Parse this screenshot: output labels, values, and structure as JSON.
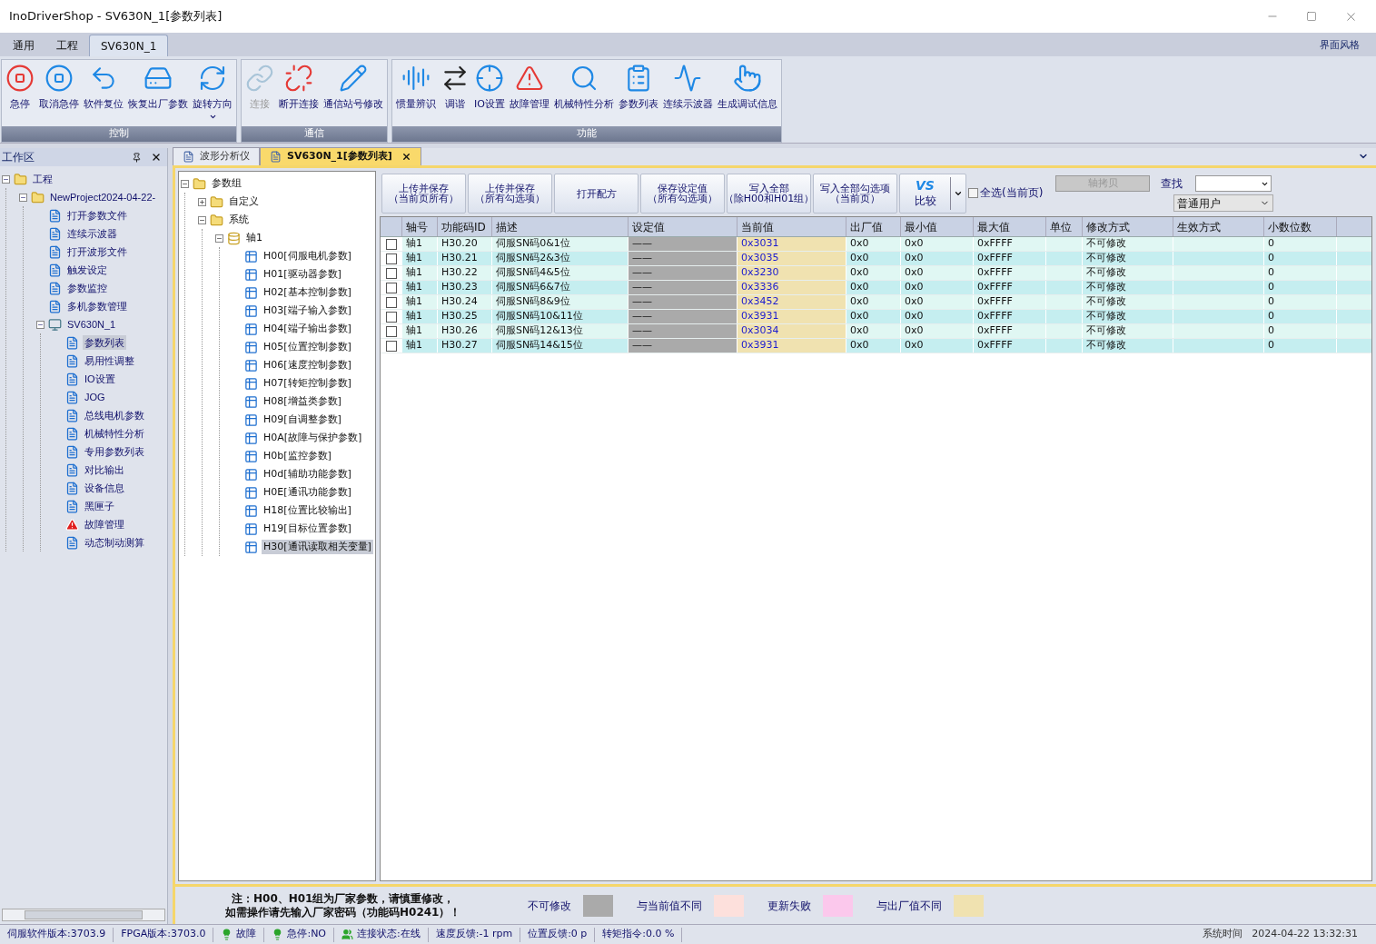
{
  "window": {
    "title": "InoDriverShop - SV630N_1[参数列表]"
  },
  "ribbon": {
    "tabs": [
      {
        "label": "通用",
        "selected": false
      },
      {
        "label": "工程",
        "selected": false
      },
      {
        "label": "SV630N_1",
        "selected": true
      }
    ],
    "style_link": "界面风格",
    "groups": [
      {
        "label": "控制",
        "buttons": [
          {
            "label": "急停",
            "disabled": false,
            "has_menu": false
          },
          {
            "label": "取消急停",
            "disabled": false,
            "has_menu": false
          },
          {
            "label": "软件复位",
            "disabled": false,
            "has_menu": false
          },
          {
            "label": "恢复出厂参数",
            "disabled": false,
            "has_menu": false
          },
          {
            "label": "旋转方向",
            "disabled": false,
            "has_menu": true
          }
        ]
      },
      {
        "label": "通信",
        "buttons": [
          {
            "label": "连接",
            "disabled": true,
            "has_menu": false
          },
          {
            "label": "断开连接",
            "disabled": false,
            "has_menu": false
          },
          {
            "label": "通信站号修改",
            "disabled": false,
            "has_menu": false
          }
        ]
      },
      {
        "label": "功能",
        "buttons": [
          {
            "label": "惯量辨识",
            "disabled": false,
            "has_menu": false
          },
          {
            "label": "调谐",
            "disabled": false,
            "has_menu": false
          },
          {
            "label": "IO设置",
            "disabled": false,
            "has_menu": false
          },
          {
            "label": "故障管理",
            "disabled": false,
            "has_menu": false
          },
          {
            "label": "机械特性分析",
            "disabled": false,
            "has_menu": false
          },
          {
            "label": "参数列表",
            "disabled": false,
            "has_menu": false
          },
          {
            "label": "连续示波器",
            "disabled": false,
            "has_menu": false
          },
          {
            "label": "生成调试信息",
            "disabled": false,
            "has_menu": false
          }
        ]
      }
    ]
  },
  "workspace": {
    "title": "工作区",
    "tree": [
      {
        "label": "工程",
        "kind": "folder",
        "selected": false,
        "expanded": true,
        "children": [
          {
            "label": "NewProject2024-04-22-",
            "kind": "folder",
            "selected": false,
            "expanded": true,
            "children": [
              {
                "label": "打开参数文件",
                "kind": "item",
                "selected": false
              },
              {
                "label": "连续示波器",
                "kind": "item",
                "selected": false
              },
              {
                "label": "打开波形文件",
                "kind": "item",
                "selected": false
              },
              {
                "label": "触发设定",
                "kind": "item",
                "selected": false
              },
              {
                "label": "参数监控",
                "kind": "item",
                "selected": false
              },
              {
                "label": "多机参数管理",
                "kind": "item",
                "selected": false
              },
              {
                "label": "SV630N_1",
                "kind": "device",
                "selected": false,
                "expanded": true,
                "children": [
                  {
                    "label": "参数列表",
                    "kind": "item",
                    "selected": true
                  },
                  {
                    "label": "易用性调整",
                    "kind": "item",
                    "selected": false
                  },
                  {
                    "label": "IO设置",
                    "kind": "item",
                    "selected": false
                  },
                  {
                    "label": "JOG",
                    "kind": "item",
                    "selected": false
                  },
                  {
                    "label": "总线电机参数",
                    "kind": "item",
                    "selected": false
                  },
                  {
                    "label": "机械特性分析",
                    "kind": "item",
                    "selected": false
                  },
                  {
                    "label": "专用参数列表",
                    "kind": "item",
                    "selected": false
                  },
                  {
                    "label": "对比输出",
                    "kind": "item",
                    "selected": false
                  },
                  {
                    "label": "设备信息",
                    "kind": "item",
                    "selected": false
                  },
                  {
                    "label": "黑匣子",
                    "kind": "item",
                    "selected": false
                  },
                  {
                    "label": "故障管理",
                    "kind": "alert",
                    "selected": false
                  },
                  {
                    "label": "动态制动测算",
                    "kind": "item",
                    "selected": false
                  }
                ]
              }
            ]
          }
        ]
      }
    ]
  },
  "doc_tabs": [
    {
      "label": "波形分析仪",
      "selected": false
    },
    {
      "label": "SV630N_1[参数列表]",
      "selected": true
    }
  ],
  "param_tree": [
    {
      "label": "参数组",
      "kind": "folder",
      "selected": false,
      "expanded": true,
      "children": [
        {
          "label": "自定义",
          "kind": "folder",
          "selected": false,
          "expanded": false
        },
        {
          "label": "系统",
          "kind": "folder",
          "selected": false,
          "expanded": true,
          "children": [
            {
              "label": "轴1",
              "kind": "axis",
              "selected": false,
              "expanded": true,
              "children": [
                {
                  "label": "H00[伺服电机参数]",
                  "kind": "group",
                  "selected": false
                },
                {
                  "label": "H01[驱动器参数]",
                  "kind": "group",
                  "selected": false
                },
                {
                  "label": "H02[基本控制参数]",
                  "kind": "group",
                  "selected": false
                },
                {
                  "label": "H03[端子输入参数]",
                  "kind": "group",
                  "selected": false
                },
                {
                  "label": "H04[端子输出参数]",
                  "kind": "group",
                  "selected": false
                },
                {
                  "label": "H05[位置控制参数]",
                  "kind": "group",
                  "selected": false
                },
                {
                  "label": "H06[速度控制参数]",
                  "kind": "group",
                  "selected": false
                },
                {
                  "label": "H07[转矩控制参数]",
                  "kind": "group",
                  "selected": false
                },
                {
                  "label": "H08[增益类参数]",
                  "kind": "group",
                  "selected": false
                },
                {
                  "label": "H09[自调整参数]",
                  "kind": "group",
                  "selected": false
                },
                {
                  "label": "H0A[故障与保护参数]",
                  "kind": "group",
                  "selected": false
                },
                {
                  "label": "H0b[监控参数]",
                  "kind": "group",
                  "selected": false
                },
                {
                  "label": "H0d[辅助功能参数]",
                  "kind": "group",
                  "selected": false
                },
                {
                  "label": "H0E[通讯功能参数]",
                  "kind": "group",
                  "selected": false
                },
                {
                  "label": "H18[位置比较输出]",
                  "kind": "group",
                  "selected": false
                },
                {
                  "label": "H19[目标位置参数]",
                  "kind": "group",
                  "selected": false
                },
                {
                  "label": "H30[通讯读取相关变量]",
                  "kind": "group",
                  "selected": true
                }
              ]
            }
          ]
        }
      ]
    }
  ],
  "toolbar": {
    "buttons": [
      {
        "line1": "上传并保存",
        "line2": "（当前页所有）"
      },
      {
        "line1": "上传并保存",
        "line2": "（所有勾选项）"
      },
      {
        "line1": "打开配方"
      },
      {
        "line1": "保存设定值",
        "line2": "（所有勾选项）"
      },
      {
        "line1": "写入全部",
        "line2": "（除H00和H01组）"
      },
      {
        "line1": "写入全部勾选项",
        "line2": "（当前页）"
      }
    ],
    "compare": {
      "logo": "VS",
      "label": "比较"
    },
    "select_all": {
      "label": "全选(当前页)",
      "checked": false
    },
    "axis_copy": {
      "label": "轴拷贝",
      "disabled": true
    },
    "find": {
      "label": "查找"
    },
    "user_level": {
      "value": "普通用户"
    }
  },
  "table": {
    "columns": [
      "轴号",
      "功能码ID",
      "描述",
      "设定值",
      "当前值",
      "出厂值",
      "最小值",
      "最大值",
      "单位",
      "修改方式",
      "生效方式",
      "小数位数"
    ],
    "rows": [
      {
        "checked": false,
        "cells": [
          "轴1",
          "H30.20",
          "伺服SN码0&1位",
          "——",
          "0x3031",
          "0x0",
          "0x0",
          "0xFFFF",
          "",
          "不可修改",
          "",
          "0"
        ]
      },
      {
        "checked": false,
        "cells": [
          "轴1",
          "H30.21",
          "伺服SN码2&3位",
          "——",
          "0x3035",
          "0x0",
          "0x0",
          "0xFFFF",
          "",
          "不可修改",
          "",
          "0"
        ]
      },
      {
        "checked": false,
        "cells": [
          "轴1",
          "H30.22",
          "伺服SN码4&5位",
          "——",
          "0x3230",
          "0x0",
          "0x0",
          "0xFFFF",
          "",
          "不可修改",
          "",
          "0"
        ]
      },
      {
        "checked": false,
        "cells": [
          "轴1",
          "H30.23",
          "伺服SN码6&7位",
          "——",
          "0x3336",
          "0x0",
          "0x0",
          "0xFFFF",
          "",
          "不可修改",
          "",
          "0"
        ]
      },
      {
        "checked": false,
        "cells": [
          "轴1",
          "H30.24",
          "伺服SN码8&9位",
          "——",
          "0x3452",
          "0x0",
          "0x0",
          "0xFFFF",
          "",
          "不可修改",
          "",
          "0"
        ]
      },
      {
        "checked": false,
        "cells": [
          "轴1",
          "H30.25",
          "伺服SN码10&11位",
          "——",
          "0x3931",
          "0x0",
          "0x0",
          "0xFFFF",
          "",
          "不可修改",
          "",
          "0"
        ]
      },
      {
        "checked": false,
        "cells": [
          "轴1",
          "H30.26",
          "伺服SN码12&13位",
          "——",
          "0x3034",
          "0x0",
          "0x0",
          "0xFFFF",
          "",
          "不可修改",
          "",
          "0"
        ]
      },
      {
        "checked": false,
        "cells": [
          "轴1",
          "H30.27",
          "伺服SN码14&15位",
          "——",
          "0x3931",
          "0x0",
          "0x0",
          "0xFFFF",
          "",
          "不可修改",
          "",
          "0"
        ]
      }
    ]
  },
  "legend": {
    "note": [
      "注：H00、H01组为厂家参数，请慎重修改，",
      "如需操作请先输入厂家密码（功能码H0241）！"
    ],
    "items": [
      {
        "label": "不可修改",
        "color": "#aaaaaa"
      },
      {
        "label": "与当前值不同",
        "color": "#fde0dc"
      },
      {
        "label": "更新失败",
        "color": "#fbc8ec"
      },
      {
        "label": "与出厂值不同",
        "color": "#f0e2b0"
      }
    ]
  },
  "status_bar": [
    {
      "kind": "text",
      "text": "伺服软件版本:3703.9"
    },
    {
      "kind": "text",
      "text": "FPGA版本:3703.0"
    },
    {
      "kind": "bulb",
      "text": "故障"
    },
    {
      "kind": "bulb",
      "text": "急停:NO"
    },
    {
      "kind": "person",
      "text": "连接状态:在线"
    },
    {
      "kind": "text",
      "text": "速度反馈:-1 rpm"
    },
    {
      "kind": "text",
      "text": "位置反馈:0 p"
    },
    {
      "kind": "text",
      "text": "转矩指令:0.0 %"
    }
  ],
  "status_right": [
    "系统时间",
    "2024-04-22 13:32:31"
  ]
}
